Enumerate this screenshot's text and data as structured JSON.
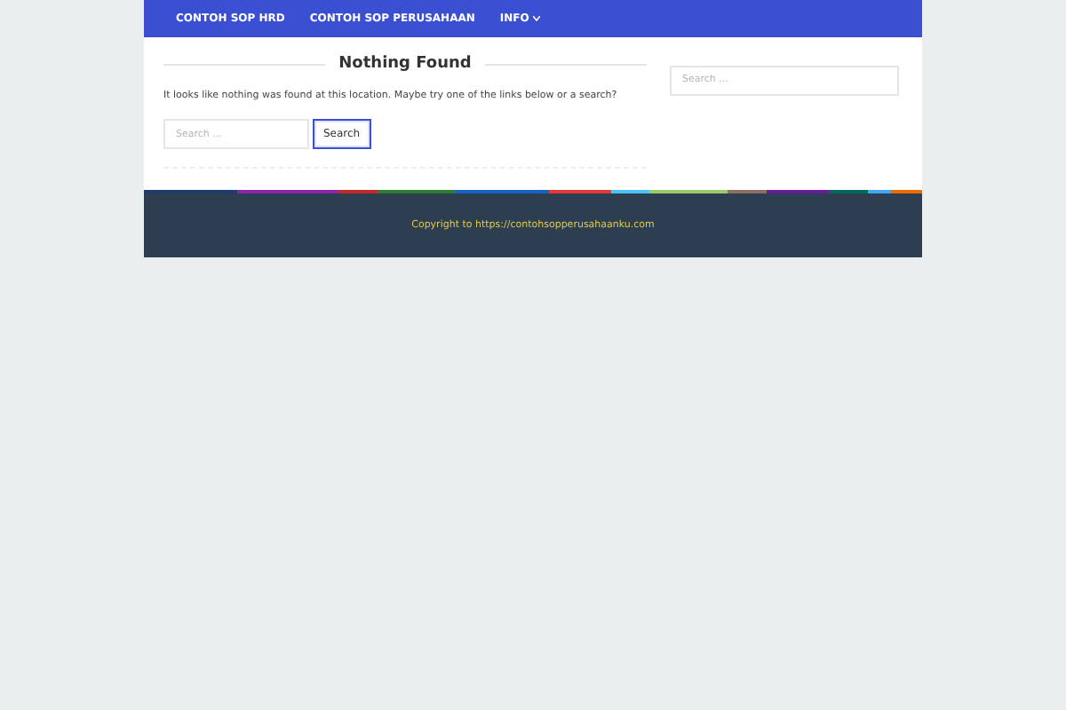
{
  "nav": {
    "items": [
      {
        "label": "CONTOH SOP HRD",
        "has_dropdown": false
      },
      {
        "label": "CONTOH SOP PERUSAHAAN",
        "has_dropdown": false
      },
      {
        "label": "INFO",
        "has_dropdown": true
      }
    ]
  },
  "main": {
    "heading": "Nothing Found",
    "message": "It looks like nothing was found at this location. Maybe try one of the links below or a search?",
    "search": {
      "placeholder": "Search ...",
      "button": "Search"
    }
  },
  "sidebar": {
    "search": {
      "placeholder": "Search ..."
    }
  },
  "footer": {
    "copyright": "Copyright to https://contohsopperusahaanku.com"
  }
}
